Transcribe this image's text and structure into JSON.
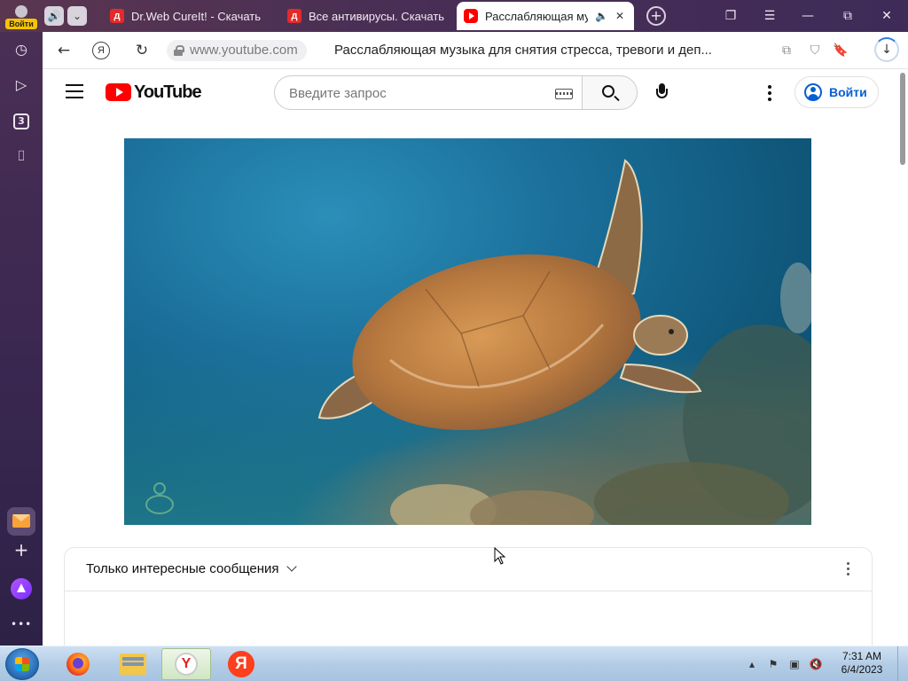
{
  "browser": {
    "profile_label": "Войти",
    "tabs": [
      {
        "title": "Dr.Web CureIt! - Скачать",
        "favicon": "drweb-icon",
        "active": false
      },
      {
        "title": "Все антивирусы. Скачать",
        "favicon": "drweb-icon",
        "active": false
      },
      {
        "title": "Расслабляющая му",
        "favicon": "youtube-icon",
        "active": true
      }
    ],
    "sidebar_tab_count": "3",
    "address": {
      "domain": "www.youtube.com",
      "page_title": "Расслабляющая музыка для снятия стресса, тревоги и деп..."
    },
    "new_tab_symbol": "+"
  },
  "youtube": {
    "logo_text": "YouTube",
    "search": {
      "placeholder": "Введите запрос",
      "value": ""
    },
    "signin_label": "Войти",
    "video": {
      "description": "sea-turtle-underwater"
    },
    "chat": {
      "mode_label": "Только интересные сообщения"
    }
  },
  "taskbar": {
    "time": "7:31 AM",
    "date": "6/4/2023",
    "yandex_letter": "Я",
    "ybrowser_letter": "Y"
  },
  "colors": {
    "youtube_red": "#ff0000",
    "link_blue": "#065fd4",
    "browser_frame": "#4a2f55"
  }
}
